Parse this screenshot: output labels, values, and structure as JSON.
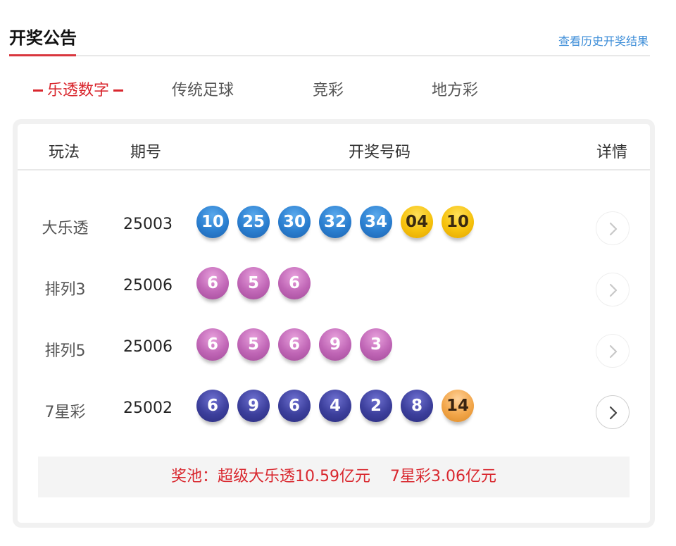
{
  "header": {
    "title": "开奖公告",
    "history_link": "查看历史开奖结果"
  },
  "tabs": [
    {
      "label": "乐透数字",
      "active": true
    },
    {
      "label": "传统足球",
      "active": false
    },
    {
      "label": "竞彩",
      "active": false
    },
    {
      "label": "地方彩",
      "active": false
    }
  ],
  "table": {
    "headers": {
      "play": "玩法",
      "issue": "期号",
      "numbers": "开奖号码",
      "detail": "详情"
    },
    "rows": [
      {
        "name": "大乐透",
        "issue": "25003",
        "balls": [
          {
            "n": "10",
            "color": "blue"
          },
          {
            "n": "25",
            "color": "blue"
          },
          {
            "n": "30",
            "color": "blue"
          },
          {
            "n": "32",
            "color": "blue"
          },
          {
            "n": "34",
            "color": "blue"
          },
          {
            "n": "04",
            "color": "yellow"
          },
          {
            "n": "10",
            "color": "yellow"
          }
        ]
      },
      {
        "name": "排列3",
        "issue": "25006",
        "balls": [
          {
            "n": "6",
            "color": "pink"
          },
          {
            "n": "5",
            "color": "pink"
          },
          {
            "n": "6",
            "color": "pink"
          }
        ]
      },
      {
        "name": "排列5",
        "issue": "25006",
        "balls": [
          {
            "n": "6",
            "color": "pink"
          },
          {
            "n": "5",
            "color": "pink"
          },
          {
            "n": "6",
            "color": "pink"
          },
          {
            "n": "9",
            "color": "pink"
          },
          {
            "n": "3",
            "color": "pink"
          }
        ]
      },
      {
        "name": "7星彩",
        "issue": "25002",
        "balls": [
          {
            "n": "6",
            "color": "navy"
          },
          {
            "n": "9",
            "color": "navy"
          },
          {
            "n": "6",
            "color": "navy"
          },
          {
            "n": "4",
            "color": "navy"
          },
          {
            "n": "2",
            "color": "navy"
          },
          {
            "n": "8",
            "color": "navy"
          },
          {
            "n": "14",
            "color": "orange"
          }
        ]
      }
    ]
  },
  "pool": {
    "prefix": "奖池：",
    "item1": "超级大乐透10.59亿元",
    "item2": "7星彩3.06亿元"
  },
  "colors": {
    "accent_red": "#d9272e",
    "link_blue": "#3e8ed8",
    "ball_blue": "#2b7fd0",
    "ball_yellow": "#f6c20d",
    "ball_pink": "#c066b6",
    "ball_navy": "#3c3f9c",
    "ball_orange": "#f2a64a"
  },
  "icons": {
    "detail": "chevron-right-icon"
  }
}
